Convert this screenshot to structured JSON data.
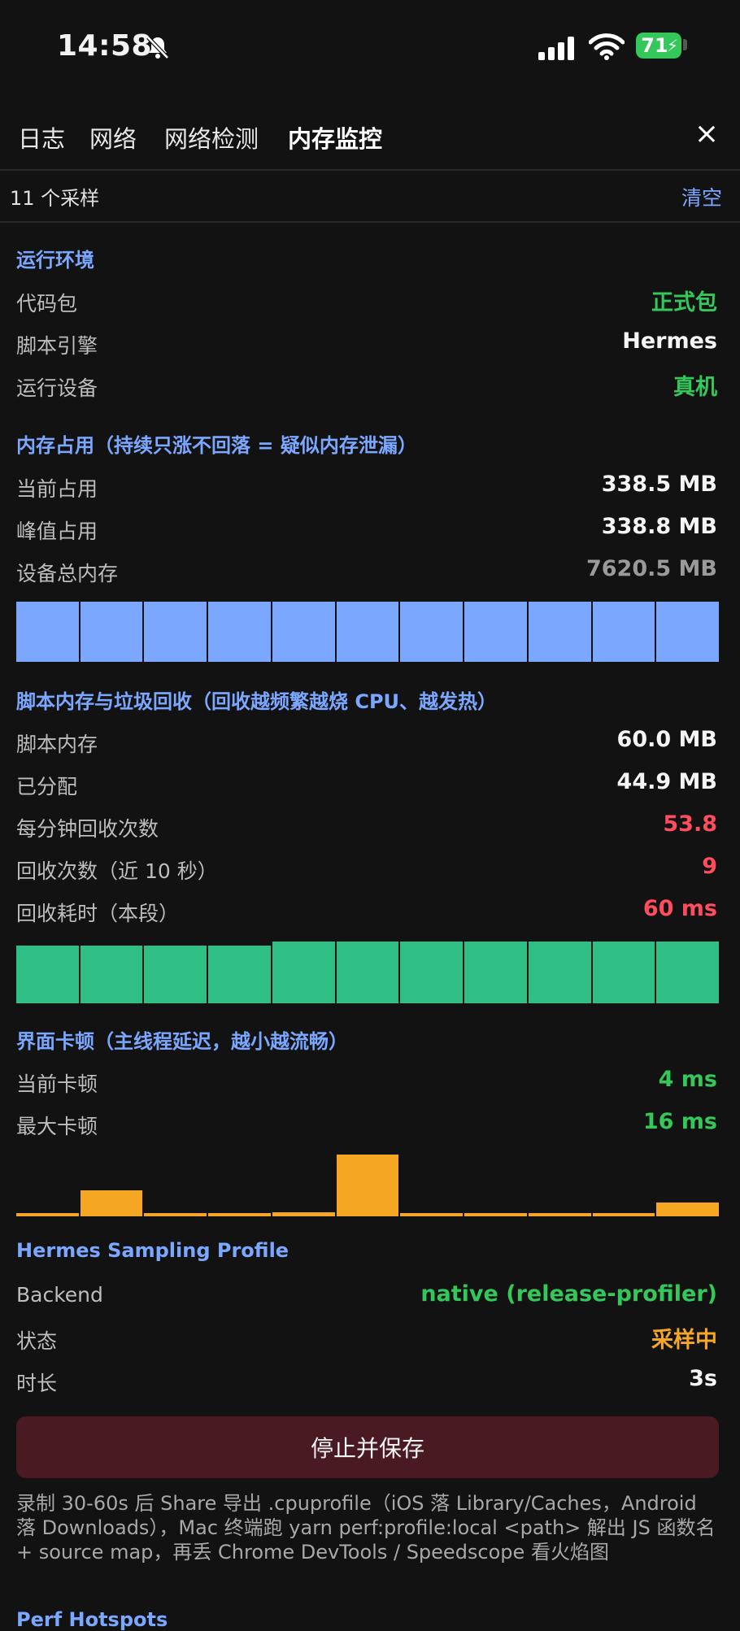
{
  "status_bar": {
    "time": "14:58",
    "battery": "71",
    "icons": [
      "bell-slash-icon",
      "cell-signal-icon",
      "wifi-icon",
      "battery-icon",
      "charging-bolt-icon"
    ]
  },
  "tabs": [
    {
      "label": "日志"
    },
    {
      "label": "网络"
    },
    {
      "label": "网络检测"
    },
    {
      "label": "内存监控",
      "active": true
    }
  ],
  "close_icon": "×",
  "samples": {
    "label": "11 个采样",
    "clear_label": "清空"
  },
  "colors": {
    "accent": "#7aa7ff",
    "memory_bar": "#7ba7ff",
    "gc_bar": "#2fbf84",
    "jank_bar": "#f5a623",
    "stop_button": "#4a1a22"
  },
  "runtime": {
    "title": "运行环境",
    "rows": [
      {
        "label": "代码包",
        "value": "正式包"
      },
      {
        "label": "脚本引擎",
        "value": "Hermes"
      },
      {
        "label": "运行设备",
        "value": "真机"
      }
    ]
  },
  "memory": {
    "title": "内存占用（持续只涨不回落 = 疑似内存泄漏）",
    "rows": [
      {
        "label": "当前占用",
        "value": "338.5 MB"
      },
      {
        "label": "峰值占用",
        "value": "338.8 MB"
      },
      {
        "label": "设备总内存",
        "value": "7620.5 MB"
      }
    ],
    "bar_levels": [
      1,
      1,
      1,
      1,
      1,
      1,
      1,
      1,
      1,
      1,
      1
    ]
  },
  "gc": {
    "title": "脚本内存与垃圾回收（回收越频繁越烧 CPU、越发热）",
    "rows": [
      {
        "label": "脚本内存",
        "value": "60.0 MB"
      },
      {
        "label": "已分配",
        "value": "44.9 MB"
      },
      {
        "label": "每分钟回收次数",
        "value": "53.8"
      },
      {
        "label": "回收次数（近 10 秒）",
        "value": "9"
      },
      {
        "label": "回收耗时（本段）",
        "value": "60 ms"
      }
    ],
    "bar_levels": [
      0.93,
      0.93,
      0.93,
      0.93,
      1,
      1,
      1,
      1,
      1,
      1,
      1
    ]
  },
  "jank": {
    "title": "界面卡顿（主线程延迟，越小越流畅）",
    "rows": [
      {
        "label": "当前卡顿",
        "value": "4 ms"
      },
      {
        "label": "最大卡顿",
        "value": "16 ms"
      }
    ],
    "bar_levels": [
      0.05,
      0.42,
      0.05,
      0.05,
      0.06,
      1,
      0.05,
      0.05,
      0.05,
      0.05,
      0.23
    ]
  },
  "profile": {
    "title": "Hermes Sampling Profile",
    "rows": [
      {
        "label": "Backend",
        "value": "native (release-profiler)"
      },
      {
        "label": "状态",
        "value": "采样中"
      },
      {
        "label": "时长",
        "value": "3s"
      }
    ],
    "stop_label": "停止并保存",
    "note": "录制 30-60s 后 Share 导出 .cpuprofile（iOS 落 Library/Caches，Android 落 Downloads），Mac 终端跑 yarn perf:profile:local <path> 解出 JS 函数名 + source map，再丢 Chrome DevTools / Speedscope 看火焰图"
  },
  "next_section": {
    "title": "Perf Hotspots"
  }
}
